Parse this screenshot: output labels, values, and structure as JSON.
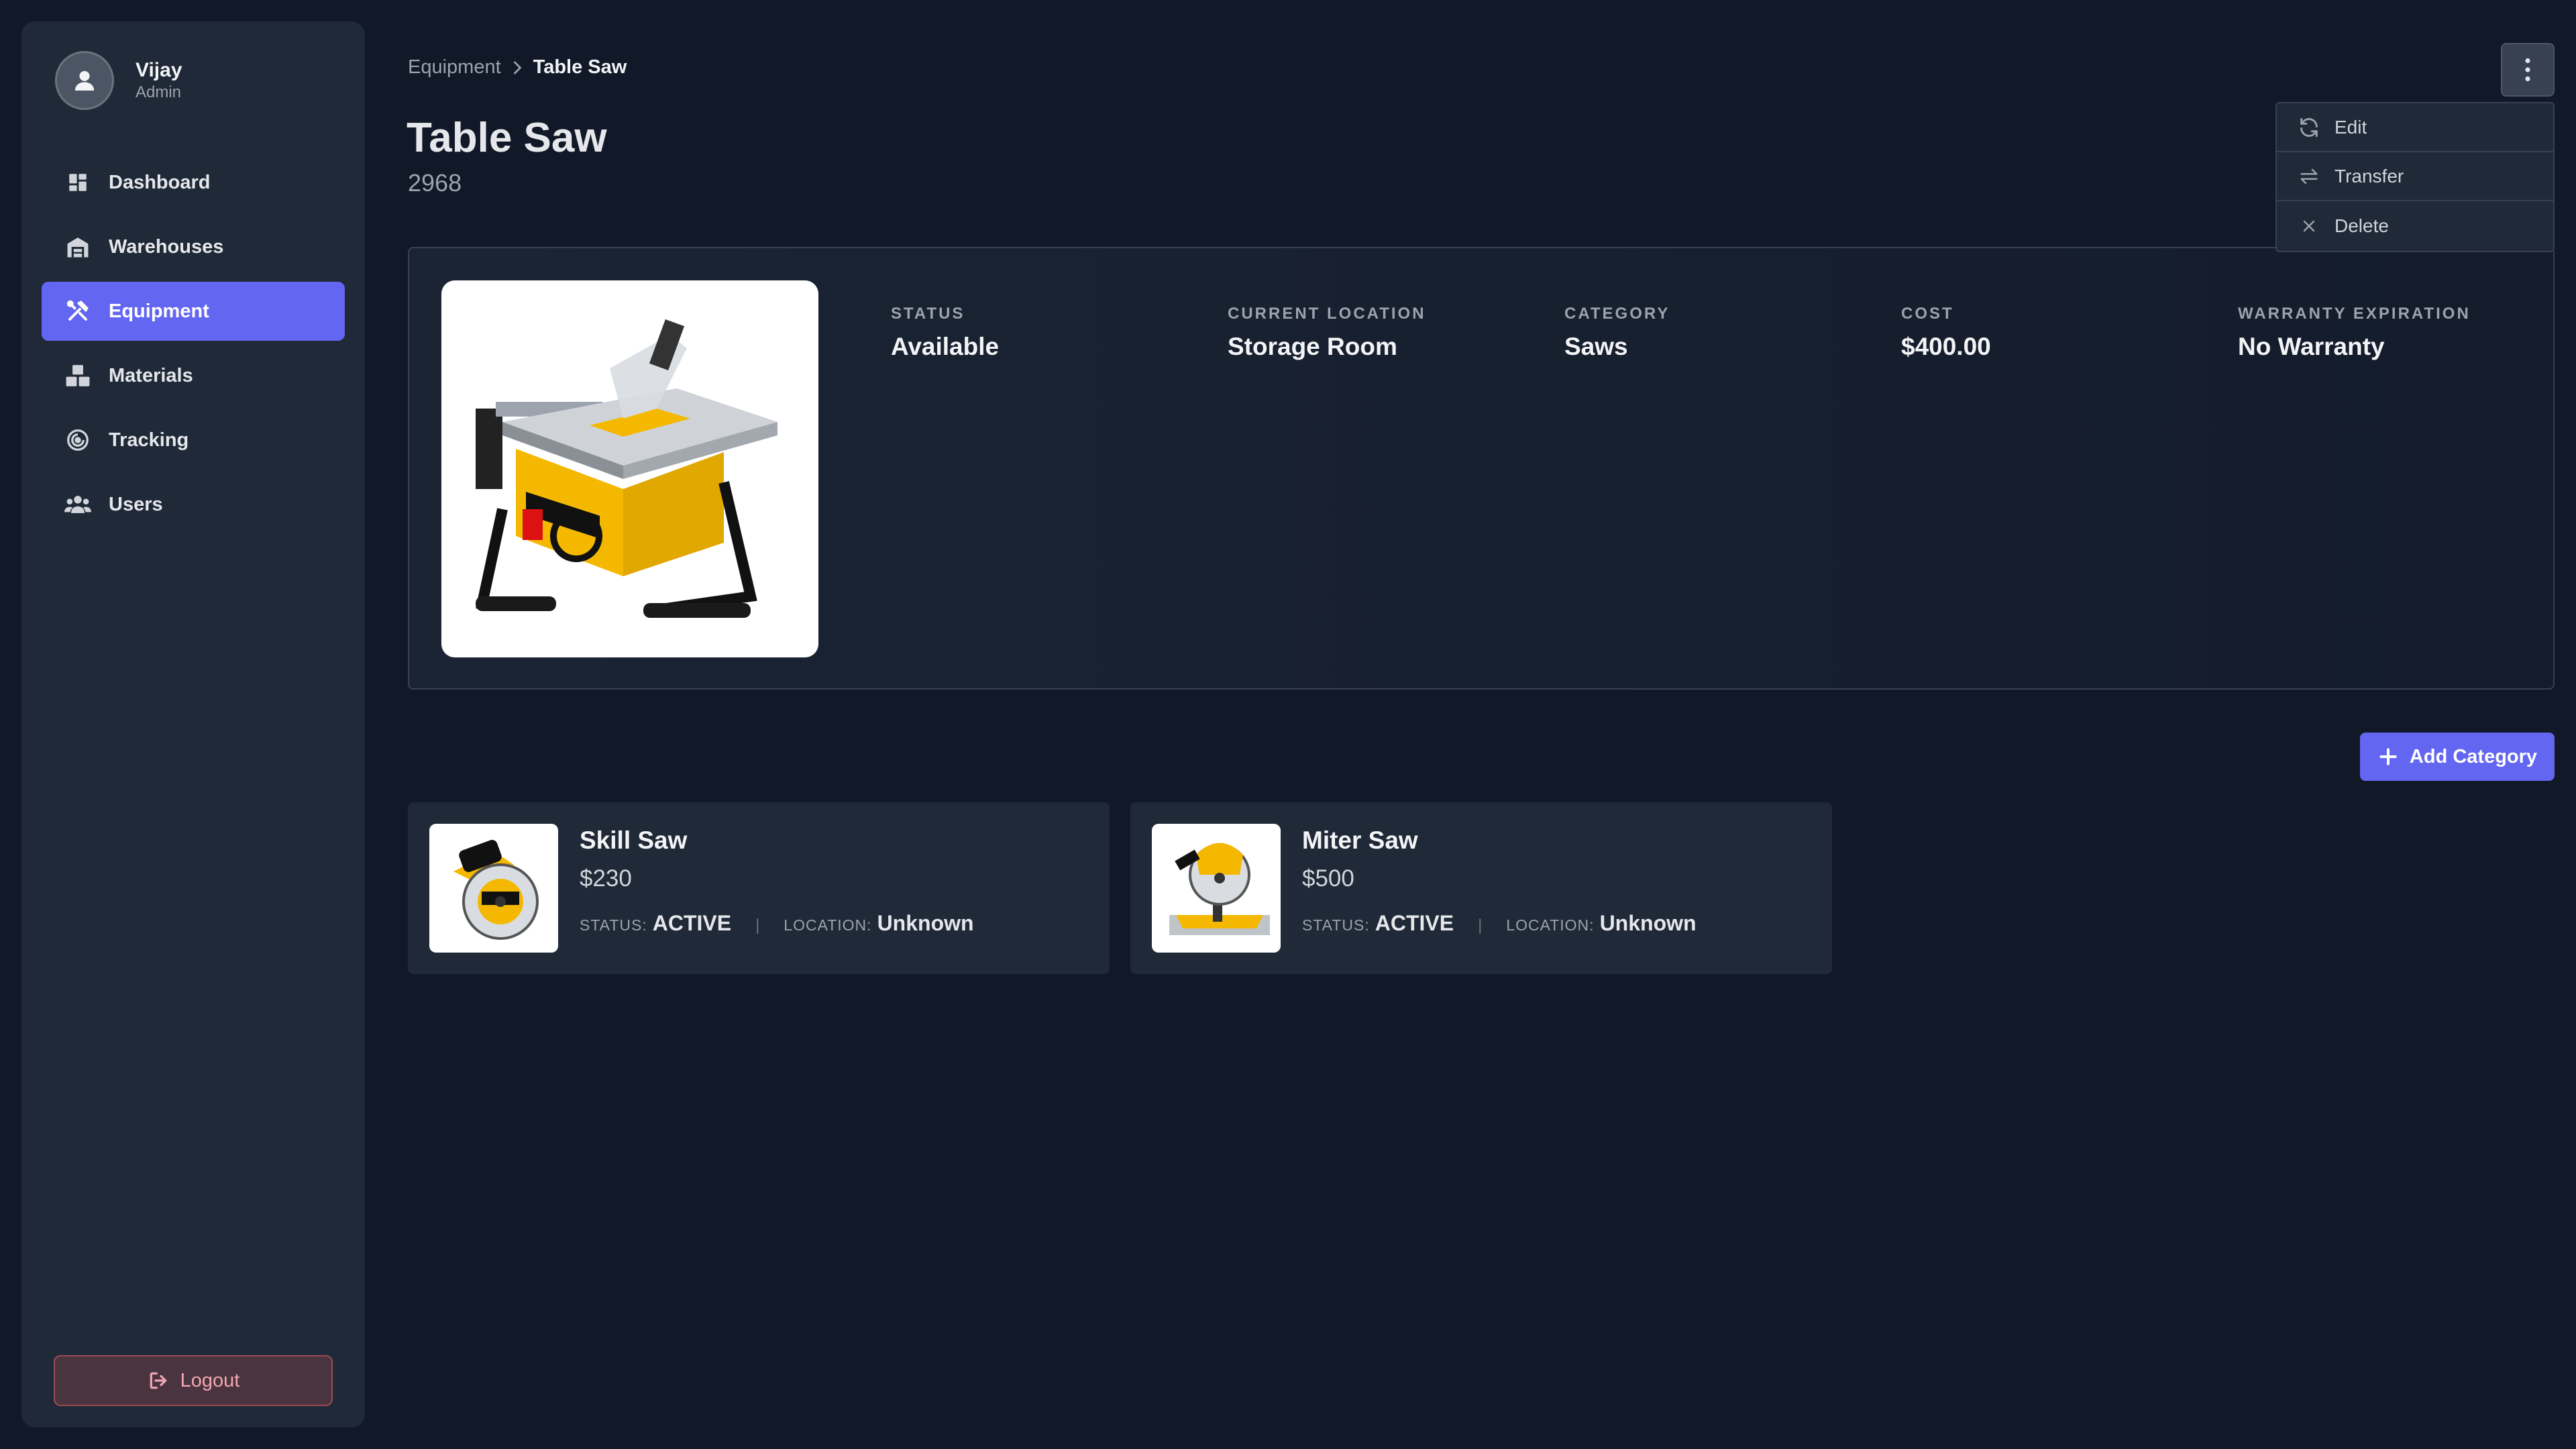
{
  "user": {
    "name": "Vijay",
    "role": "Admin"
  },
  "nav": {
    "items": [
      {
        "label": "Dashboard",
        "icon": "dashboard-icon"
      },
      {
        "label": "Warehouses",
        "icon": "warehouse-icon"
      },
      {
        "label": "Equipment",
        "icon": "tools-icon",
        "active": true
      },
      {
        "label": "Materials",
        "icon": "boxes-icon"
      },
      {
        "label": "Tracking",
        "icon": "tracking-icon"
      },
      {
        "label": "Users",
        "icon": "users-icon"
      }
    ],
    "logout_label": "Logout"
  },
  "breadcrumb": {
    "parent": "Equipment",
    "current": "Table Saw"
  },
  "item": {
    "title": "Table Saw",
    "id": "2968",
    "image_icon": "table-saw-image",
    "stats": [
      {
        "label": "STATUS",
        "value": "Available"
      },
      {
        "label": "CURRENT LOCATION",
        "value": "Storage Room"
      },
      {
        "label": "CATEGORY",
        "value": "Saws"
      },
      {
        "label": "COST",
        "value": "$400.00"
      },
      {
        "label": "WARRANTY EXPIRATION",
        "value": "No Warranty"
      }
    ]
  },
  "menu": {
    "items": [
      {
        "label": "Edit",
        "icon": "refresh-icon"
      },
      {
        "label": "Transfer",
        "icon": "transfer-icon"
      },
      {
        "label": "Delete",
        "icon": "close-icon"
      }
    ]
  },
  "actions": {
    "add_category_label": "Add Category"
  },
  "related": [
    {
      "title": "Skill Saw",
      "price": "$230",
      "status_label": "STATUS:",
      "status": "ACTIVE",
      "location_label": "LOCATION:",
      "location": "Unknown",
      "image_icon": "circular-saw-image"
    },
    {
      "title": "Miter Saw",
      "price": "$500",
      "status_label": "STATUS:",
      "status": "ACTIVE",
      "location_label": "LOCATION:",
      "location": "Unknown",
      "image_icon": "miter-saw-image"
    }
  ],
  "colors": {
    "accent": "#6366f1",
    "background": "#111827",
    "sidebar": "#1f2937",
    "brand_yellow": "#f5b800"
  }
}
